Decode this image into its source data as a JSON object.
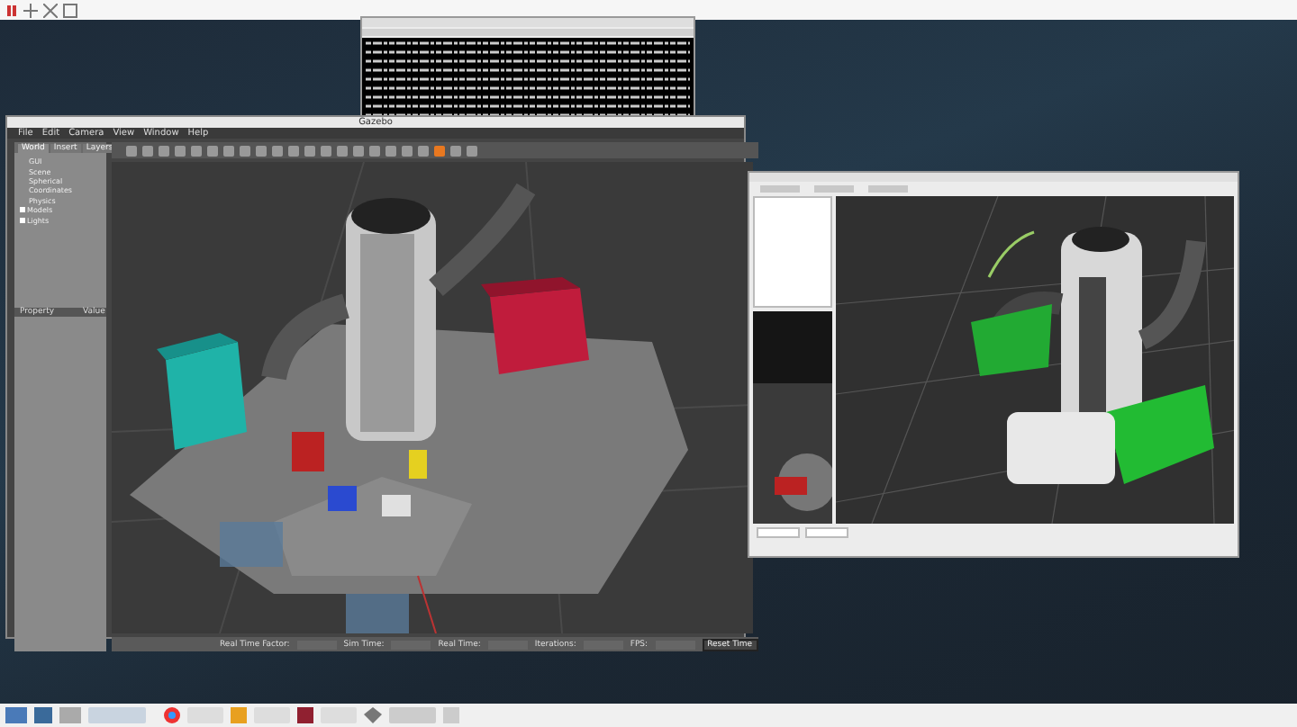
{
  "gazebo": {
    "title": "Gazebo",
    "menu": [
      "File",
      "Edit",
      "Camera",
      "View",
      "Window",
      "Help"
    ],
    "tabs": [
      {
        "label": "World",
        "selected": true
      },
      {
        "label": "Insert",
        "selected": false
      },
      {
        "label": "Layers",
        "selected": false
      }
    ],
    "tree": [
      {
        "label": "GUI",
        "kind": "leaf"
      },
      {
        "label": "Scene",
        "kind": "leaf"
      },
      {
        "label": "Spherical Coordinates",
        "kind": "leaf"
      },
      {
        "label": "Physics",
        "kind": "leaf"
      },
      {
        "label": "Models",
        "kind": "group"
      },
      {
        "label": "Lights",
        "kind": "group"
      }
    ],
    "property_columns": [
      "Property",
      "Value"
    ],
    "status_labels": [
      "Real Time Factor:",
      "Sim Time:",
      "Real Time:",
      "Iterations:",
      "FPS:"
    ],
    "reset_button": "Reset Time"
  }
}
